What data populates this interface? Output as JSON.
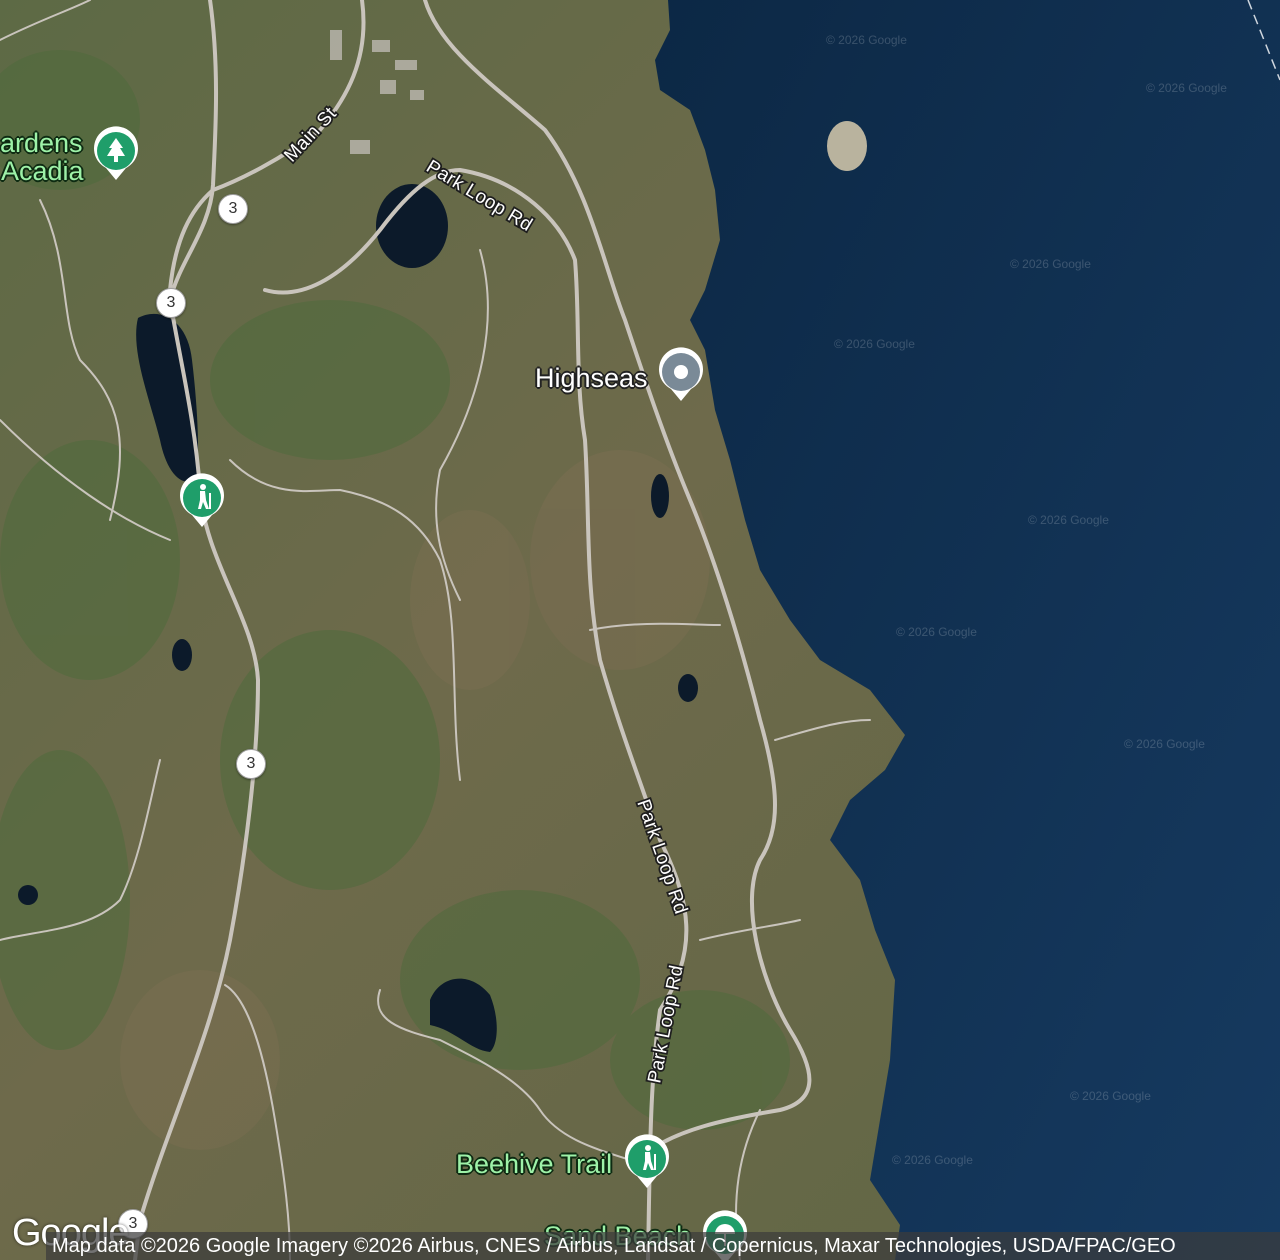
{
  "road_labels": {
    "main_st": "Main St",
    "park_loop_1": "Park Loop Rd",
    "park_loop_2": "Park Loop Rd",
    "park_loop_3": "Park Loop Rd"
  },
  "route_shields": [
    "3",
    "3",
    "3",
    "3"
  ],
  "places": {
    "gardens": {
      "line1": "ardens",
      "line2": "Acadia",
      "icon": "park-tree-icon"
    },
    "highseas": {
      "label": "Highseas",
      "icon": "location-dot-icon"
    },
    "trail_marker": {
      "icon": "hiking-icon"
    },
    "beehive": {
      "label": "Beehive Trail",
      "icon": "hiking-icon"
    },
    "sand_beach": {
      "label": "Sand Beach",
      "icon": "beach-icon"
    }
  },
  "watermark": "© 2026 Google",
  "logo": "Google",
  "attribution": "Map data ©2026 Google Imagery ©2026 Airbus, CNES / Airbus, Landsat / Copernicus, Maxar Technologies, USDA/FPAC/GEO",
  "colors": {
    "ocean": "#0f2f52",
    "land": "#6c6a4a",
    "poi_green": "#1f9e6a",
    "label_green": "#9ef2a8",
    "poi_gray": "#7a8a97"
  }
}
